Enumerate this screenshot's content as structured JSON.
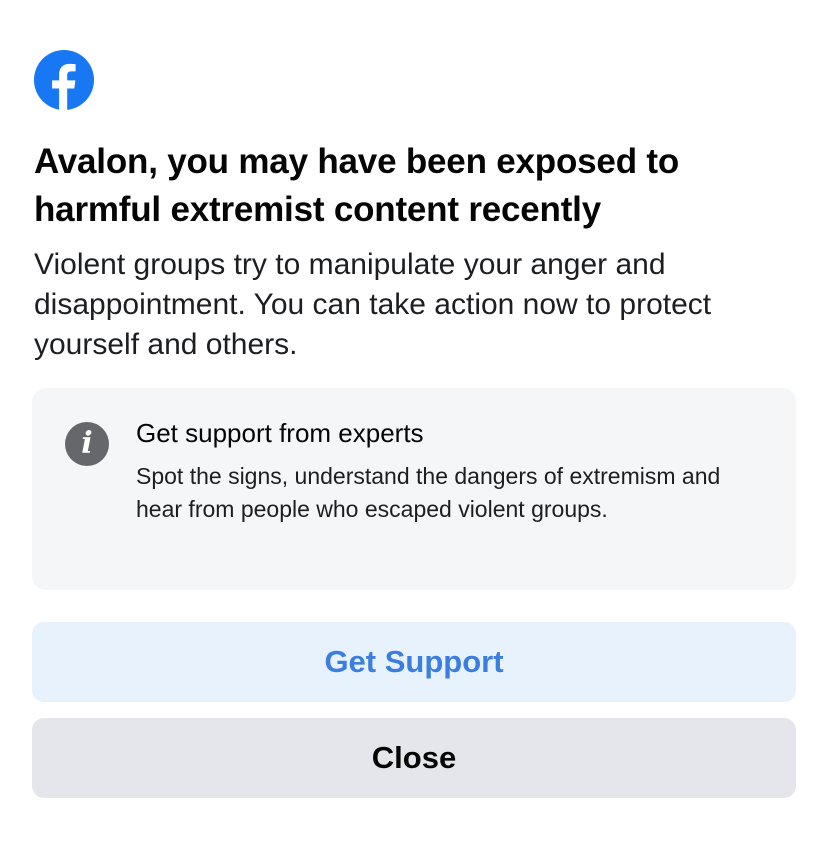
{
  "app": {
    "logo_icon": "facebook-logo-icon",
    "brand_color": "#1877F2"
  },
  "dialog": {
    "title": "Avalon, you may have been exposed to harmful extremist content recently",
    "body": "Violent groups try to manipulate your anger and disappointment. You can take action now to protect yourself and others."
  },
  "info_card": {
    "icon": "info-icon",
    "icon_glyph": "i",
    "title": "Get support from experts",
    "text": "Spot the signs, understand the dangers of extremism and hear from people who escaped violent groups."
  },
  "actions": {
    "primary_label": "Get Support",
    "secondary_label": "Close"
  }
}
